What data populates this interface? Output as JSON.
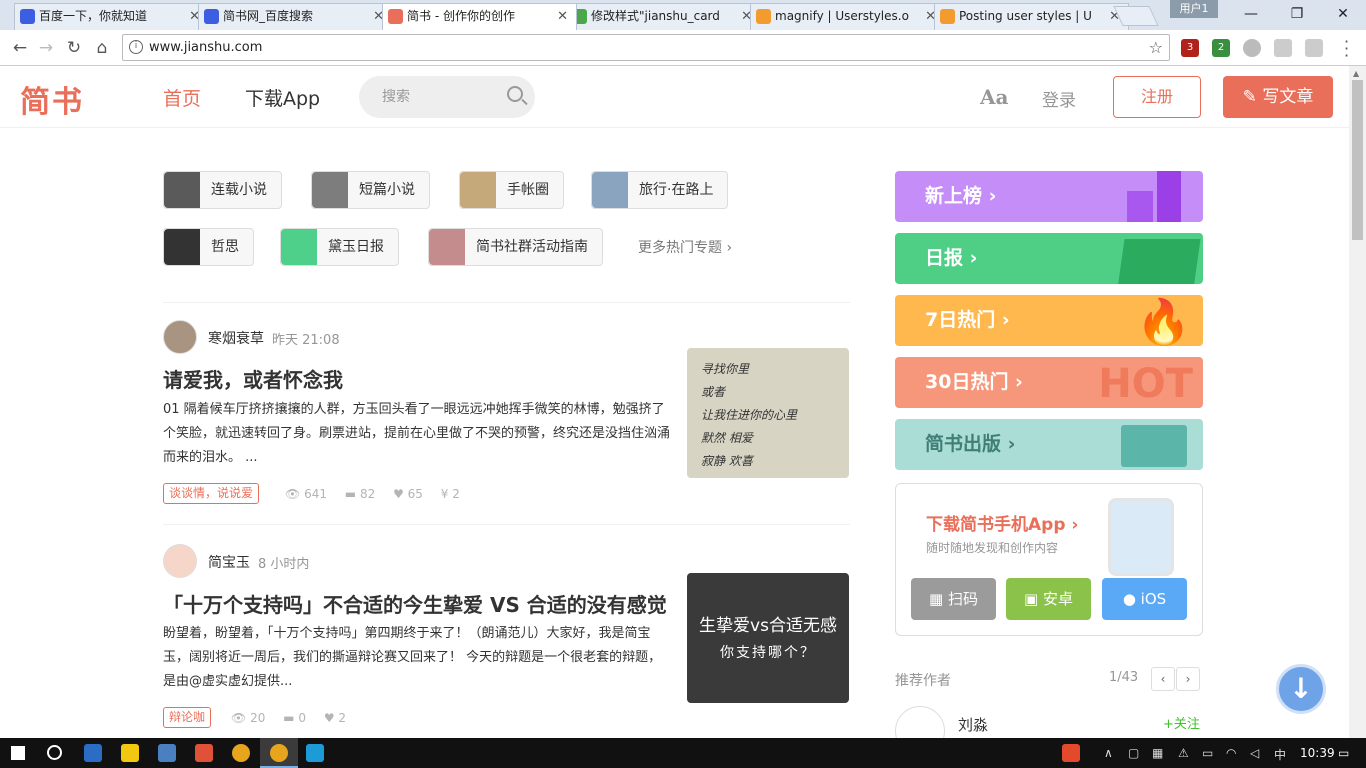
{
  "browser": {
    "tabs": [
      {
        "title": "百度一下，你就知道",
        "color": "#3b5fe0",
        "active": false
      },
      {
        "title": "简书网_百度搜索",
        "color": "#3b5fe0",
        "active": false
      },
      {
        "title": "简书 - 创作你的创作",
        "color": "#ea6f5a",
        "active": true
      },
      {
        "title": "修改样式\"jianshu_card",
        "color": "#4aa84a",
        "active": false
      },
      {
        "title": "magnify | Userstyles.o",
        "color": "#f29b2f",
        "active": false
      },
      {
        "title": "Posting user styles | U",
        "color": "#f29b2f",
        "active": false
      }
    ],
    "close_glyph": "✕",
    "user_label": "用户1",
    "window_controls": {
      "minimize": "—",
      "maximize": "❐",
      "close": "✕"
    },
    "url": "www.jianshu.com",
    "info_glyph": "i",
    "star_glyph": "☆",
    "nav": {
      "back": "←",
      "forward": "→",
      "reload": "↻",
      "home": "⌂"
    },
    "extensions": [
      {
        "label": "3",
        "color": "#b0231d"
      },
      {
        "label": "2",
        "color": "#3a8e3f"
      },
      {
        "label": "",
        "color": "#bbbbbb"
      },
      {
        "label": "",
        "color": "#cccccc"
      },
      {
        "label": "",
        "color": "#cccccc"
      }
    ]
  },
  "header": {
    "logo": "简书",
    "nav_home": "首页",
    "nav_download": "下载App",
    "search_placeholder": "搜索",
    "font_toggle": "Aa",
    "login": "登录",
    "register": "注册",
    "write": "✎ 写文章",
    "accent": "#ea6f5a"
  },
  "topics": [
    {
      "label": "连载小说",
      "thumb": "#5a5a5a"
    },
    {
      "label": "短篇小说",
      "thumb": "#7d7d7d"
    },
    {
      "label": "手帐圈",
      "thumb": "#c6a97a"
    },
    {
      "label": "旅行·在路上",
      "thumb": "#8aa4c0"
    },
    {
      "label": "哲思",
      "thumb": "#333333"
    },
    {
      "label": "黛玉日报",
      "thumb": "#4ecf8a"
    },
    {
      "label": "简书社群活动指南",
      "thumb": "#c48c8c"
    }
  ],
  "more_topics": "更多热门专题 ›",
  "articles": [
    {
      "author": "寒烟衰草",
      "time": "昨天 21:08",
      "title": "请爱我，或者怀念我",
      "abstract": "01 隔着候车厅挤挤攘攘的人群，方玉回头看了一眼远远冲她挥手微笑的林博，勉强挤了个笑脸，就迅速转回了身。刷票进站，提前在心里做了不哭的预警，终究还是没挡住汹涌而来的泪水。 ...",
      "tag": "谈谈情，说说爱",
      "views": "641",
      "comments": "82",
      "likes": "65",
      "rewards": "2",
      "image_text": [
        "寻找你里",
        "或者",
        "让我住进你的心里",
        "默然 相爱",
        "寂静 欢喜"
      ]
    },
    {
      "author": "简宝玉",
      "time": "8 小时内",
      "title": "「十万个支持吗」不合适的今生挚爱 VS 合适的没有感觉",
      "abstract": "盼望着，盼望着，「十万个支持吗」第四期终于来了！（朗诵范儿）大家好，我是简宝玉，阔别将近一周后，我们的撕逼辩论赛又回来了！ 今天的辩题是一个很老套的辩题，是由@虚实虚幻提供...",
      "tag": "辩论咖",
      "views": "20",
      "comments": "0",
      "likes": "2",
      "image_text": [
        "生挚爱vs合适无感",
        "你支持哪个？"
      ]
    }
  ],
  "meta_icons": {
    "views": "👁",
    "comments": "▬",
    "likes": "♥",
    "rewards": "¥"
  },
  "boards": [
    {
      "label": "新上榜 ›",
      "color": "#c48df7"
    },
    {
      "label": "日报 ›",
      "color": "#4fcf85"
    },
    {
      "label": "7日热门 ›",
      "color": "#ffb84d"
    },
    {
      "label": "30日热门 ›",
      "color": "#f6967a"
    },
    {
      "label": "简书出版 ›",
      "color": "#a9ddd6"
    }
  ],
  "hot_text": "HOT",
  "app_promo": {
    "title": "下载简书手机App ›",
    "subtitle": "随时随地发现和创作内容",
    "scan": "扫码",
    "android": "安卓",
    "ios": "iOS"
  },
  "recommend": {
    "title": "推荐作者",
    "pager": "1/43",
    "prev": "‹",
    "next": "›",
    "author": "刘淼",
    "follow": "+关注"
  },
  "backtop_glyph": "↓",
  "taskbar": {
    "time": "10:39"
  }
}
